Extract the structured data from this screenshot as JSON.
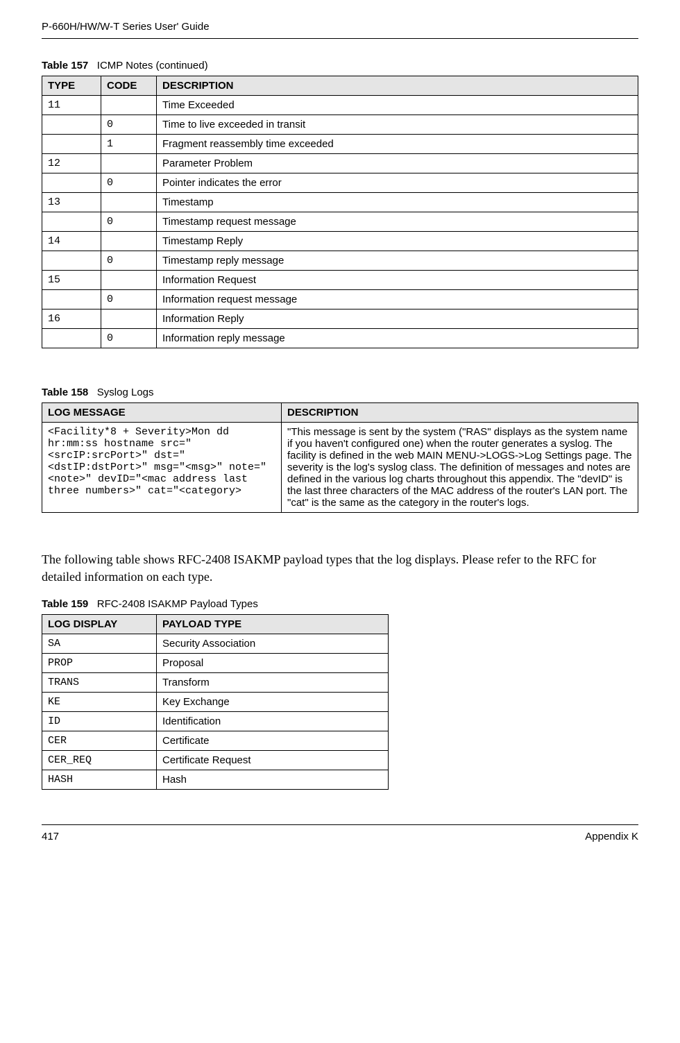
{
  "header": {
    "guide_title": "P-660H/HW/W-T Series User' Guide"
  },
  "table157": {
    "caption_prefix": "Table 157",
    "caption_text": "ICMP Notes (continued)",
    "headers": {
      "type": "TYPE",
      "code": "CODE",
      "description": "DESCRIPTION"
    },
    "rows": [
      {
        "type": "11",
        "code": "",
        "desc": "Time Exceeded"
      },
      {
        "type": "",
        "code": "0",
        "desc": "Time to live exceeded in transit"
      },
      {
        "type": "",
        "code": "1",
        "desc": "Fragment reassembly time exceeded"
      },
      {
        "type": "12",
        "code": "",
        "desc": "Parameter Problem"
      },
      {
        "type": "",
        "code": "0",
        "desc": "Pointer indicates the error"
      },
      {
        "type": "13",
        "code": "",
        "desc": "Timestamp"
      },
      {
        "type": "",
        "code": "0",
        "desc": "Timestamp request message"
      },
      {
        "type": "14",
        "code": "",
        "desc": "Timestamp Reply"
      },
      {
        "type": "",
        "code": "0",
        "desc": "Timestamp reply message"
      },
      {
        "type": "15",
        "code": "",
        "desc": "Information Request"
      },
      {
        "type": "",
        "code": "0",
        "desc": "Information request message"
      },
      {
        "type": "16",
        "code": "",
        "desc": "Information Reply"
      },
      {
        "type": "",
        "code": "0",
        "desc": "Information reply message"
      }
    ]
  },
  "table158": {
    "caption_prefix": "Table 158",
    "caption_text": "Syslog Logs",
    "headers": {
      "log_message": "LOG MESSAGE",
      "description": "DESCRIPTION"
    },
    "row": {
      "log_message": "<Facility*8 + Severity>Mon dd hr:mm:ss hostname src=\"<srcIP:srcPort>\" dst=\"<dstIP:dstPort>\" msg=\"<msg>\" note=\"<note>\" devID=\"<mac address last three numbers>\" cat=\"<category>",
      "description": "\"This message is sent by the system (\"RAS\" displays as the system name if you haven't configured one) when the router generates a syslog. The facility is defined in the web MAIN MENU->LOGS->Log Settings page. The severity is the log's syslog class. The definition of messages and notes are defined in the various log charts throughout this appendix. The \"devID\" is the last three characters of the MAC address of the router's LAN port. The \"cat\" is the same as the category in the router's logs."
    }
  },
  "intro_text": "The following table shows RFC-2408 ISAKMP payload types that the log displays. Please refer to the RFC for detailed information on each type.",
  "table159": {
    "caption_prefix": "Table 159",
    "caption_text": "RFC-2408 ISAKMP Payload Types",
    "headers": {
      "log_display": "LOG DISPLAY",
      "payload_type": "PAYLOAD TYPE"
    },
    "rows": [
      {
        "log_display": "SA",
        "payload_type": "Security Association"
      },
      {
        "log_display": "PROP",
        "payload_type": "Proposal"
      },
      {
        "log_display": "TRANS",
        "payload_type": "Transform"
      },
      {
        "log_display": "KE",
        "payload_type": "Key Exchange"
      },
      {
        "log_display": "ID",
        "payload_type": "Identification"
      },
      {
        "log_display": "CER",
        "payload_type": "Certificate"
      },
      {
        "log_display": "CER_REQ",
        "payload_type": "Certificate Request"
      },
      {
        "log_display": "HASH",
        "payload_type": "Hash"
      }
    ]
  },
  "footer": {
    "page_number": "417",
    "appendix": "Appendix K"
  }
}
